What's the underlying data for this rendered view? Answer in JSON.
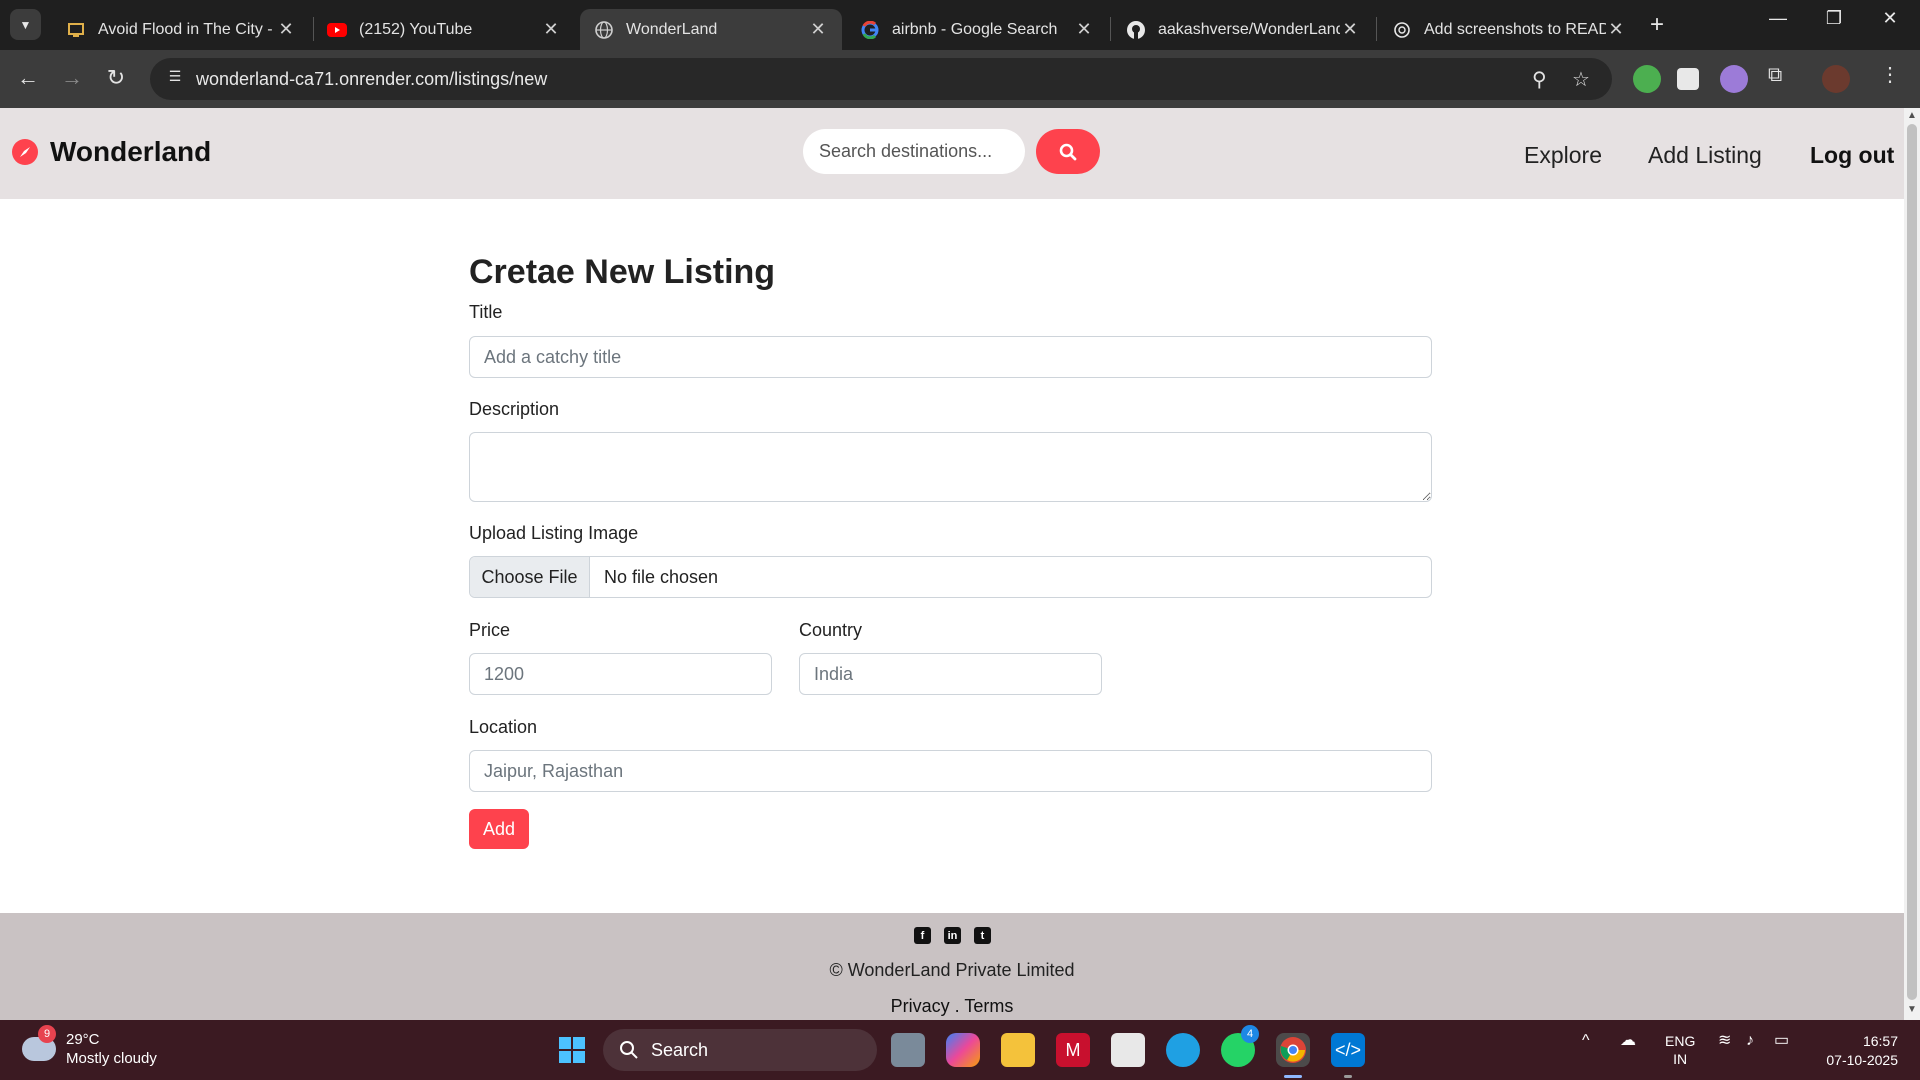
{
  "browser": {
    "tabs": [
      {
        "title": "Avoid Flood in The City - L",
        "favicon": "monitor-icon"
      },
      {
        "title": "(2152) YouTube",
        "favicon": "youtube-icon"
      },
      {
        "title": "WonderLand",
        "favicon": "globe-icon",
        "active": true
      },
      {
        "title": "airbnb - Google Search",
        "favicon": "google-icon"
      },
      {
        "title": "aakashverse/WonderLand:",
        "favicon": "github-icon"
      },
      {
        "title": "Add screenshots to READM",
        "favicon": "chatgpt-icon"
      }
    ],
    "url": "wonderland-ca71.onrender.com/listings/new"
  },
  "site": {
    "brand": "Wonderland",
    "search_placeholder": "Search destinations...",
    "nav": {
      "explore": "Explore",
      "add_listing": "Add Listing",
      "logout": "Log out"
    }
  },
  "form": {
    "heading": "Cretae New Listing",
    "title_label": "Title",
    "title_placeholder": "Add a catchy title",
    "description_label": "Description",
    "image_label": "Upload Listing Image",
    "choose_file": "Choose File",
    "no_file": "No file chosen",
    "price_label": "Price",
    "price_placeholder": "1200",
    "country_label": "Country",
    "country_placeholder": "India",
    "location_label": "Location",
    "location_placeholder": "Jaipur, Rajasthan",
    "submit": "Add"
  },
  "footer": {
    "copyright": "© WonderLand Private Limited",
    "links": "Privacy . Terms"
  },
  "taskbar": {
    "weather_badge": "9",
    "temperature": "29°C",
    "condition": "Mostly cloudy",
    "search": "Search",
    "whatsapp_badge": "4",
    "lang_top": "ENG",
    "lang_bottom": "IN",
    "time": "16:57",
    "date": "07-10-2025"
  },
  "colors": {
    "accent": "#fe424d",
    "nav_bg": "#e6e1e2",
    "footer_bg": "#c9c2c3",
    "taskbar_bg": "#3b1a22"
  }
}
